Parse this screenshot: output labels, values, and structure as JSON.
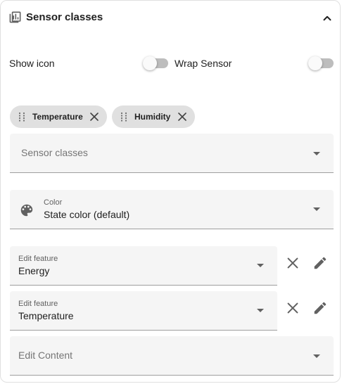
{
  "header": {
    "title": "Sensor classes",
    "icon": "chart-box-icon",
    "collapse_icon": "chevron-up-icon"
  },
  "toggles": {
    "show_icon_label": "Show icon",
    "show_icon_on": false,
    "wrap_sensor_label": "Wrap Sensor",
    "wrap_sensor_on": false
  },
  "chips": [
    {
      "label": "Temperature"
    },
    {
      "label": "Humidity"
    }
  ],
  "sensor_classes_select": {
    "placeholder": "Sensor classes"
  },
  "color_select": {
    "label": "Color",
    "value": "State color (default)",
    "icon": "palette-icon"
  },
  "features": [
    {
      "label": "Edit feature",
      "value": "Energy"
    },
    {
      "label": "Edit feature",
      "value": "Temperature"
    }
  ],
  "content_select": {
    "placeholder": "Edit Content"
  },
  "colors": {
    "icon": "#616161",
    "field_bg": "#f5f5f5",
    "chip_bg": "#e0e0e0",
    "switch_track": "#bdbdbd"
  }
}
